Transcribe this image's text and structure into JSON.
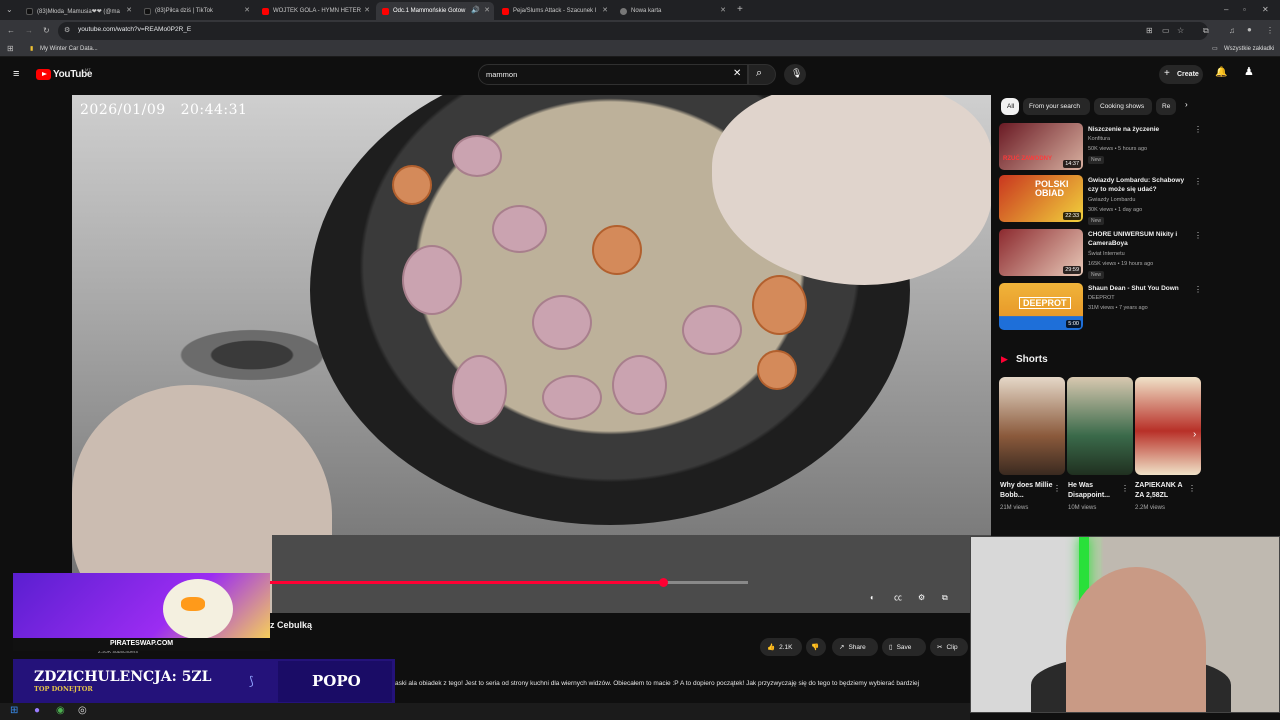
{
  "browser": {
    "tabs": [
      {
        "title": "(83)Młoda_Mamusia❤❤ (@ma",
        "active": false
      },
      {
        "title": "(83)Piłca dziś | TikTok",
        "active": false
      },
      {
        "title": "WOJTEK GOLA - HYMN HETER",
        "active": false
      },
      {
        "title": "Odc.1 Mammońskie Gotow",
        "active": true
      },
      {
        "title": "Peja/Slums Attack - Szacunek l",
        "active": false
      },
      {
        "title": "Nowa karta",
        "active": false
      }
    ],
    "url": "youtube.com/watch?v=REAMo0P2R_E",
    "bookmarks": [
      "My Winter Car Data..."
    ],
    "all_bookmarks": "Wszystkie zakładki"
  },
  "youtube": {
    "logo_text": "YouTube",
    "logo_badge": "MT",
    "search_value": "mammon",
    "create_label": "Create"
  },
  "video": {
    "overlay_date": "2026/01/09",
    "overlay_time": "20:44:31",
    "progress": 0.823,
    "title_visible": "z Cebulką",
    "channel_subs": "2.95K subscribers",
    "likes": "2.1K",
    "share_label": "Share",
    "save_label": "Save",
    "clip_label": "Clip",
    "description": "aski ala obiadek z tego! Jest to seria od strony kuchni dla wiernych widzów. Obiecałem to macie :P A to dopiero początek! Jak przyzwyczaję się do tego to będziemy wybierać bardziej"
  },
  "chips": [
    "All",
    "From your search",
    "Cooking shows",
    "Re"
  ],
  "recommendations": [
    {
      "title": "Niszczenie na życzenie",
      "channel": "Konfitura",
      "meta": "50K views • 5 hours ago",
      "badge": "New",
      "duration": "14:37",
      "colors": [
        "#6a1a24",
        "#d8b0a0"
      ]
    },
    {
      "title": "Gwiazdy Lombardu: Schabowy czy to może się udać?",
      "channel": "Gwiazdy Lombardu",
      "meta": "30K views • 1 day ago",
      "badge": "New",
      "duration": "22:33",
      "colors": [
        "#c9361f",
        "#f1d23c"
      ]
    },
    {
      "title": "CHORE UNIWERSUM Nikity i CameraBoya",
      "channel": "Świat Internetu",
      "meta": "165K views • 19 hours ago",
      "badge": "New",
      "duration": "29:59",
      "colors": [
        "#8c2a2f",
        "#e8c9b8"
      ]
    },
    {
      "title": "Shaun Dean - Shut You Down",
      "channel": "DEEPROT",
      "meta": "31M views • 7 years ago",
      "badge": "",
      "duration": "5:00",
      "colors": [
        "#f0b43a",
        "#1e6fd9"
      ]
    }
  ],
  "rec_thumb_texts": [
    "RZUĆ ZAWODNY",
    "POLSKI OBIAD",
    "",
    "DEEPROT"
  ],
  "shorts": {
    "heading": "Shorts",
    "items": [
      {
        "title": "Why does Millie Bobb...",
        "views": "21M views",
        "colors": [
          "#8b5a3c",
          "#e5d8c8"
        ]
      },
      {
        "title": "He Was Disappoint...",
        "views": "10M views",
        "colors": [
          "#3a6a4a",
          "#d8c8b0"
        ]
      },
      {
        "title": "ZAPIEKANK A ZA 2,58ZL",
        "views": "2.2M views",
        "colors": [
          "#b83028",
          "#f0e2c8"
        ]
      }
    ]
  },
  "stream": {
    "promo_site": "PIRATESWAP.COM",
    "donation_main": "ZDZICHULENCJA: 5ZL",
    "donation_sub": "TOP DONEJTOR",
    "donation_name": "POPO"
  }
}
